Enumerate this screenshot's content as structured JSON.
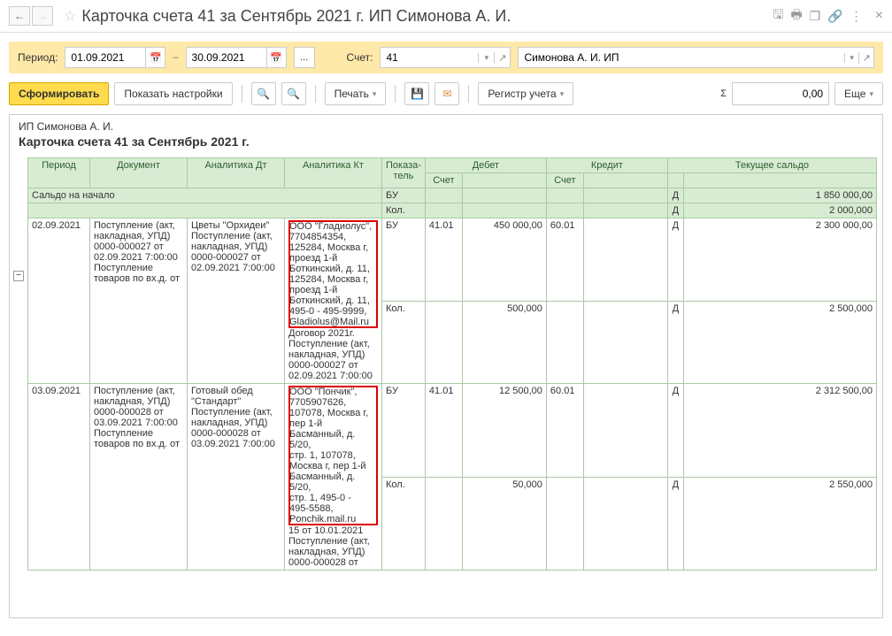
{
  "title": "Карточка счета 41 за Сентябрь 2021 г. ИП Симонова А. И.",
  "period_label": "Период:",
  "date_from": "01.09.2021",
  "date_to": "30.09.2021",
  "account_label": "Счет:",
  "account_value": "41",
  "org_value": "Симонова А. И. ИП",
  "toolbar": {
    "form_btn": "Сформировать",
    "settings_btn": "Показать настройки",
    "print_btn": "Печать",
    "register_btn": "Регистр учета",
    "sum_value": "0,00",
    "more_btn": "Еще"
  },
  "report": {
    "org": "ИП Симонова А. И.",
    "title": "Карточка счета 41 за Сентябрь 2021 г.",
    "cols": {
      "period": "Период",
      "doc": "Документ",
      "an_dt": "Аналитика Дт",
      "an_kt": "Аналитика Кт",
      "ind": "Показа-\nтель",
      "debet": "Дебет",
      "credit": "Кредит",
      "saldo": "Текущее сальдо",
      "acct": "Счет"
    },
    "saldo_start": {
      "label": "Сальдо на начало",
      "ind1": "БУ",
      "ind2": "Кол.",
      "d": "Д",
      "v1": "1 850 000,00",
      "v2": "2 000,000"
    },
    "rows": [
      {
        "date": "02.09.2021",
        "doc": "Поступление (акт, накладная, УПД) 0000-000027 от 02.09.2021 7:00:00\nПоступление товаров по вх.д.  от",
        "an_dt": "Цветы \"Орхидеи\"\nПоступление (акт, накладная, УПД) 0000-000027 от 02.09.2021 7:00:00",
        "an_kt_hl": "ООО \"Гладиолус\",\n7704854354,\n125284, Москва г,\nпроезд 1-й Боткинский, д. 11,\n125284, Москва г,\nпроезд 1-й Боткинский, д. 11,\n495-0 - 495-9999,\nGladiolus@Mail.ru",
        "an_kt_rest": "Договор 2021г.\nПоступление (акт, накладная, УПД) 0000-000027 от 02.09.2021 7:00:00",
        "ind1": "БУ",
        "d_acct": "41.01",
        "d_val": "450 000,00",
        "k_acct": "60.01",
        "s_d": "Д",
        "s_v": "2 300 000,00",
        "ind2": "Кол.",
        "d_val2": "500,000",
        "s_d2": "Д",
        "s_v2": "2 500,000"
      },
      {
        "date": "03.09.2021",
        "doc": "Поступление (акт, накладная, УПД) 0000-000028 от 03.09.2021 7:00:00\nПоступление товаров по вх.д.  от",
        "an_dt": "Готовый обед \"Стандарт\"\nПоступление (акт, накладная, УПД) 0000-000028 от 03.09.2021 7:00:00",
        "an_kt_hl": "ООО \"Пончик\",\n7705907626,\n107078, Москва г,\nпер 1-й Басманный, д. 5/20,\nстр. 1, 107078,\nМосква г, пер 1-й Басманный, д. 5/20,\nстр. 1, 495-0 -\n495-5588,\nPonchik.mail.ru",
        "an_kt_rest": "15 от 10.01.2021\nПоступление (акт, накладная, УПД) 0000-000028 от",
        "ind1": "БУ",
        "d_acct": "41.01",
        "d_val": "12 500,00",
        "k_acct": "60.01",
        "s_d": "Д",
        "s_v": "2 312 500,00",
        "ind2": "Кол.",
        "d_val2": "50,000",
        "s_d2": "Д",
        "s_v2": "2 550,000"
      }
    ]
  }
}
